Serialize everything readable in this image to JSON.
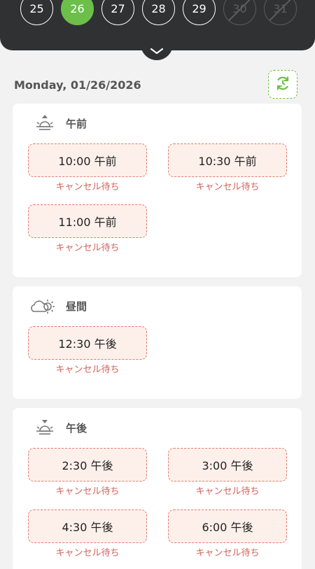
{
  "calendar": {
    "days": [
      {
        "label": "25",
        "state": "normal"
      },
      {
        "label": "26",
        "state": "selected"
      },
      {
        "label": "27",
        "state": "normal"
      },
      {
        "label": "28",
        "state": "normal"
      },
      {
        "label": "29",
        "state": "normal"
      },
      {
        "label": "30",
        "state": "disabled"
      },
      {
        "label": "31",
        "state": "disabled"
      }
    ]
  },
  "selected_date": "Monday,  01/26/2026",
  "colors": {
    "accent": "#6cc04a",
    "header_bg": "#2f3133",
    "slot_border": "#e07a6f",
    "slot_bg": "#fdf0ea",
    "status_text": "#d4625a"
  },
  "icons": {
    "collapse": "chevron-down-icon",
    "refresh": "refresh-icon",
    "morning": "sunrise-icon",
    "midday": "cloud-sun-icon",
    "afternoon": "sunset-icon"
  },
  "sections": {
    "morning": {
      "title": "午前",
      "slots": [
        {
          "time": "10:00 午前",
          "status": "キャンセル待ち"
        },
        {
          "time": "10:30 午前",
          "status": "キャンセル待ち"
        },
        {
          "time": "11:00 午前",
          "status": "キャンセル待ち"
        }
      ]
    },
    "midday": {
      "title": "昼間",
      "slots": [
        {
          "time": "12:30 午後",
          "status": "キャンセル待ち"
        }
      ]
    },
    "afternoon": {
      "title": "午後",
      "slots": [
        {
          "time": "2:30 午後",
          "status": "キャンセル待ち"
        },
        {
          "time": "3:00 午後",
          "status": "キャンセル待ち"
        },
        {
          "time": "4:30 午後",
          "status": "キャンセル待ち"
        },
        {
          "time": "6:00 午後",
          "status": "キャンセル待ち"
        }
      ]
    }
  }
}
